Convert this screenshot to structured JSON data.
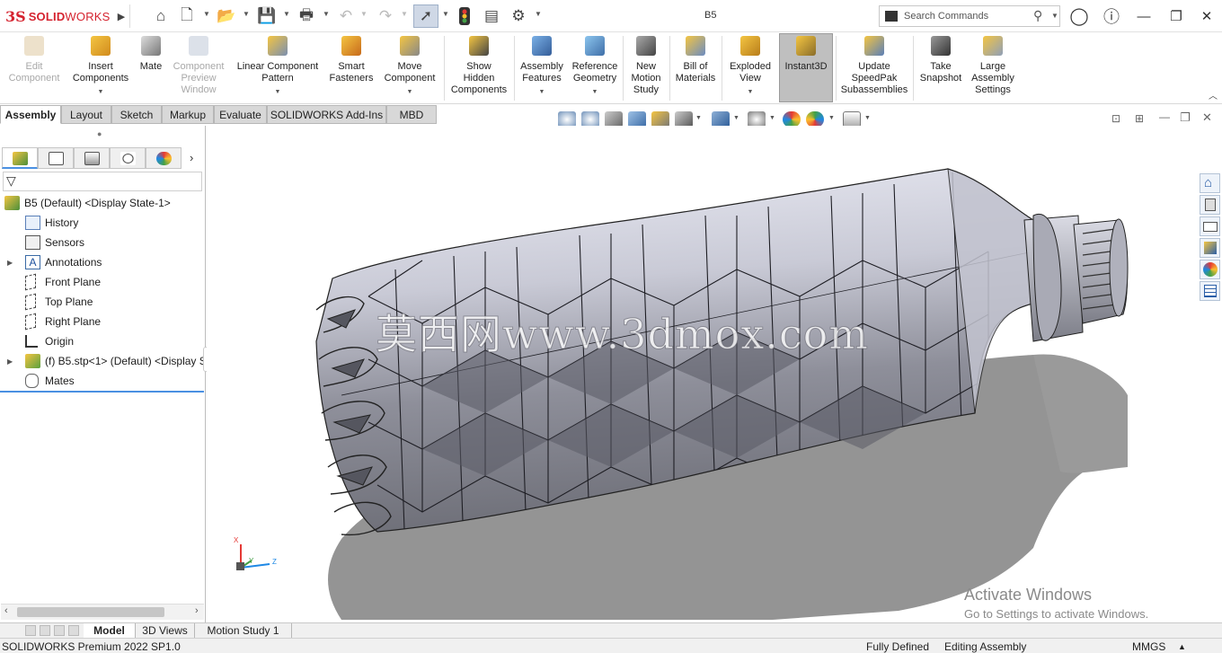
{
  "titlebar": {
    "logo_ds": "3S",
    "logo_text": "SOLID",
    "logo_text2": "WORKS",
    "document_title": "B5",
    "search_placeholder": "Search Commands"
  },
  "command_manager": [
    {
      "label": "Edit\nComponent",
      "enabled": false
    },
    {
      "label": "Insert\nComponents",
      "enabled": true
    },
    {
      "label": "Mate",
      "enabled": true
    },
    {
      "label": "Component\nPreview\nWindow",
      "enabled": false
    },
    {
      "label": "Linear Component\nPattern",
      "enabled": true
    },
    {
      "label": "Smart\nFasteners",
      "enabled": true
    },
    {
      "label": "Move\nComponent",
      "enabled": true
    },
    {
      "label": "Show\nHidden\nComponents",
      "enabled": true
    },
    {
      "label": "Assembly\nFeatures",
      "enabled": true
    },
    {
      "label": "Reference\nGeometry",
      "enabled": true
    },
    {
      "label": "New\nMotion\nStudy",
      "enabled": true
    },
    {
      "label": "Bill of\nMaterials",
      "enabled": true
    },
    {
      "label": "Exploded\nView",
      "enabled": true
    },
    {
      "label": "Instant3D",
      "enabled": true,
      "active": true
    },
    {
      "label": "Update\nSpeedPak\nSubassemblies",
      "enabled": true
    },
    {
      "label": "Take\nSnapshot",
      "enabled": true
    },
    {
      "label": "Large\nAssembly\nSettings",
      "enabled": true
    }
  ],
  "tabs": [
    "Assembly",
    "Layout",
    "Sketch",
    "Markup",
    "Evaluate",
    "SOLIDWORKS Add-Ins",
    "MBD"
  ],
  "active_tab": "Assembly",
  "feature_tree": [
    {
      "label": "B5  (Default) <Display State-1>",
      "icon": "assembly-icon",
      "expandable": false
    },
    {
      "label": "History",
      "icon": "history-icon",
      "expandable": false
    },
    {
      "label": "Sensors",
      "icon": "sensors-icon",
      "expandable": false
    },
    {
      "label": "Annotations",
      "icon": "annotations-icon",
      "expandable": true
    },
    {
      "label": "Front Plane",
      "icon": "plane-icon",
      "expandable": false
    },
    {
      "label": "Top Plane",
      "icon": "plane-icon",
      "expandable": false
    },
    {
      "label": "Right Plane",
      "icon": "plane-icon",
      "expandable": false
    },
    {
      "label": "Origin",
      "icon": "origin-icon",
      "expandable": false
    },
    {
      "label": "(f) B5.stp<1> (Default) <Display S",
      "icon": "part-icon",
      "expandable": true
    },
    {
      "label": "Mates",
      "icon": "mates-icon",
      "expandable": false
    }
  ],
  "viewport": {
    "watermark": "莫西网www.3dmox.com",
    "activate_windows_title": "Activate Windows",
    "activate_windows_sub": "Go to Settings to activate Windows.",
    "triad": {
      "x": "X",
      "y": "Y",
      "z": "Z"
    }
  },
  "bottom_tabs": [
    "Model",
    "3D Views",
    "Motion Study 1"
  ],
  "active_bottom_tab": "Model",
  "status": {
    "product": "SOLIDWORKS Premium 2022 SP1.0",
    "definition": "Fully Defined",
    "mode": "Editing Assembly",
    "units": "MMGS",
    "units_arrow": "▲"
  },
  "colors": {
    "brand_red": "#d5232f",
    "accent_blue": "#4a90e2",
    "model_gray": "#b9bac6"
  }
}
